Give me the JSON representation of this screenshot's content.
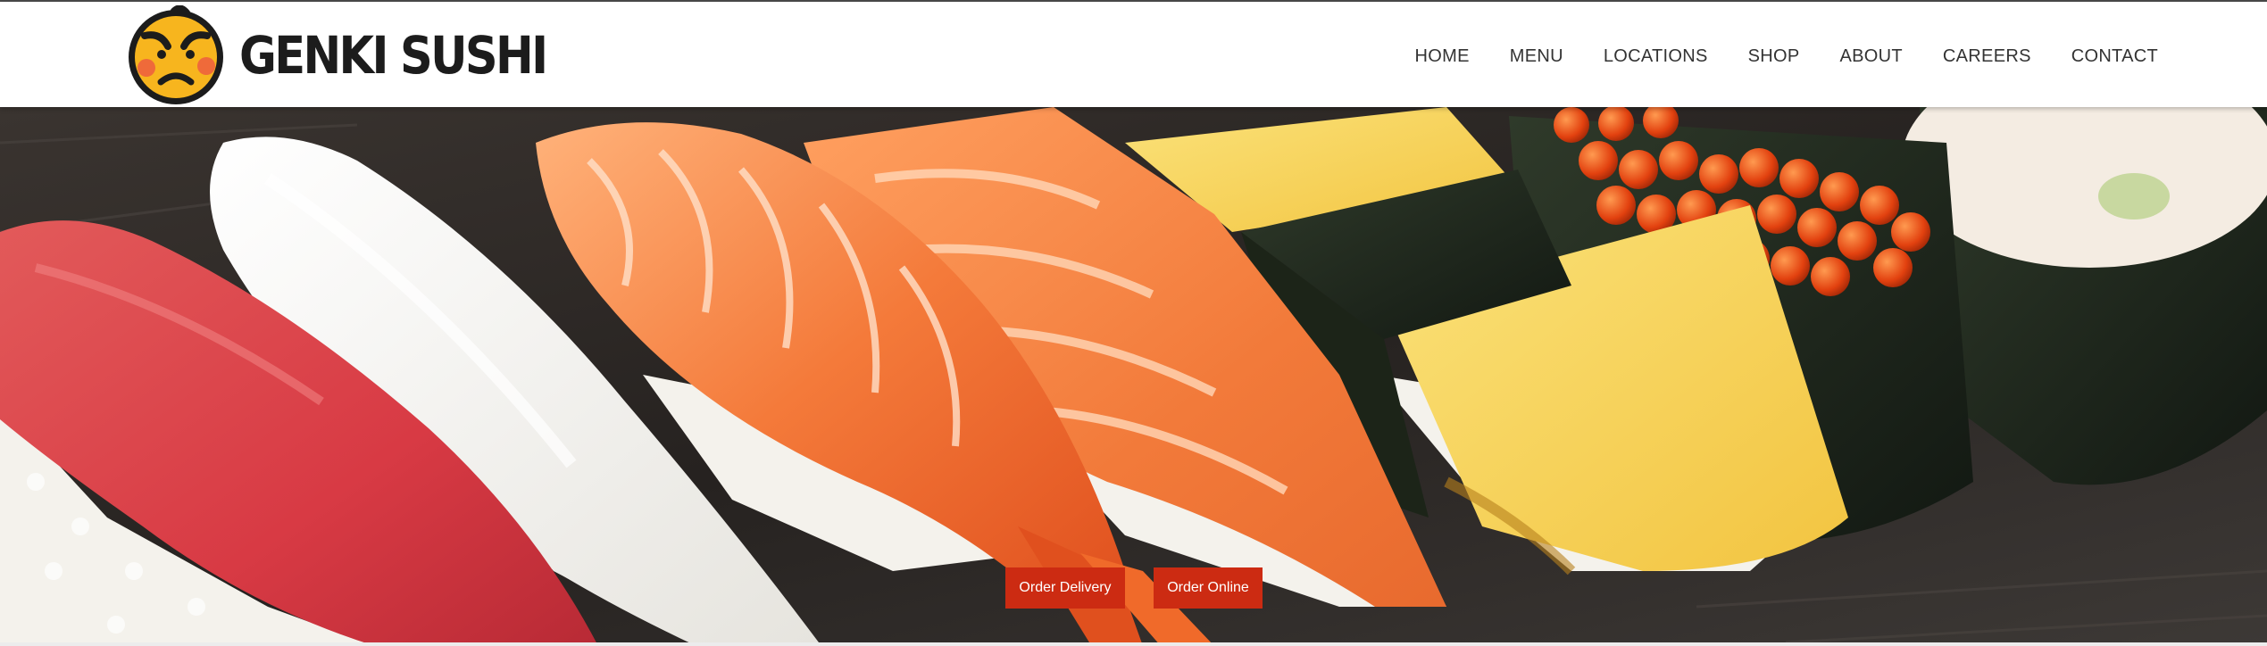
{
  "brand": {
    "name": "GENKI SUSHI",
    "logo_icon": "angry-face-icon"
  },
  "nav": {
    "items": [
      {
        "label": "HOME"
      },
      {
        "label": "MENU"
      },
      {
        "label": "LOCATIONS"
      },
      {
        "label": "SHOP"
      },
      {
        "label": "ABOUT"
      },
      {
        "label": "CAREERS"
      },
      {
        "label": "CONTACT"
      }
    ]
  },
  "hero": {
    "image": "sushi-platter-photo"
  },
  "cta": {
    "delivery_label": "Order Delivery",
    "online_label": "Order Online"
  },
  "colors": {
    "cta_background": "#cc2b12",
    "logo_yellow": "#f7b51e",
    "nav_text": "#333333"
  }
}
